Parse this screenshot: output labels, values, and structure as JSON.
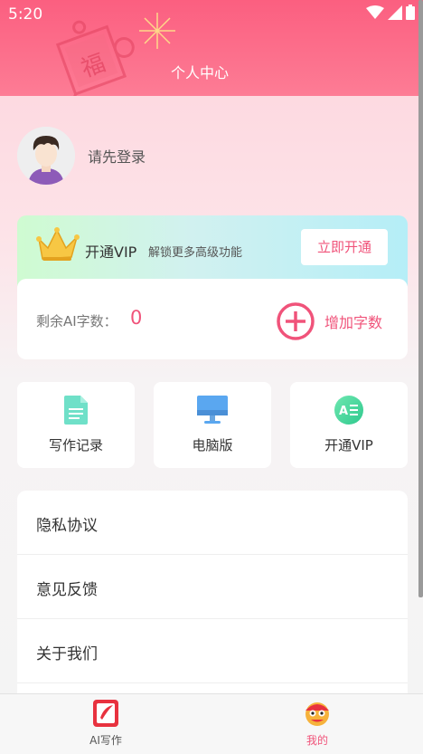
{
  "status_bar": {
    "time": "5:20"
  },
  "header": {
    "title": "个人中心",
    "deco_char": "福"
  },
  "profile": {
    "login_prompt": "请先登录"
  },
  "vip_banner": {
    "title": "开通VIP",
    "subtitle": "解锁更多高级功能",
    "button": "立即开通"
  },
  "quota": {
    "label": "剩余AI字数：",
    "value": "0",
    "add_label": "增加字数"
  },
  "tiles": [
    {
      "label": "写作记录",
      "icon": "document-icon"
    },
    {
      "label": "电脑版",
      "icon": "monitor-icon"
    },
    {
      "label": "开通VIP",
      "icon": "ai-list-icon"
    }
  ],
  "menu": [
    {
      "label": "隐私协议"
    },
    {
      "label": "意见反馈"
    },
    {
      "label": "关于我们"
    }
  ],
  "tabbar": [
    {
      "label": "AI写作",
      "icon": "writing-app-icon",
      "active": false
    },
    {
      "label": "我的",
      "icon": "lion-dance-icon",
      "active": true
    }
  ],
  "colors": {
    "accent": "#f0537a",
    "header": "#fb6a87",
    "tile_doc": "#6fe0c8",
    "tile_monitor": "#5aa7f0"
  }
}
